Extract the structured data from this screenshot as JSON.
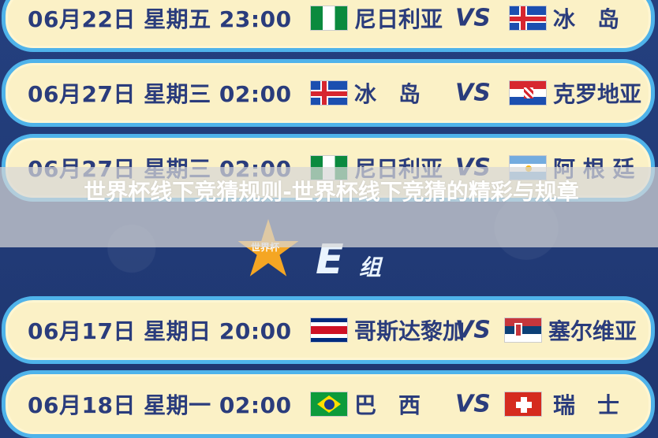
{
  "matches_top": [
    {
      "date": "06月22日 星期五 23:00",
      "home": "尼日利亚",
      "home_flag": "nigeria-flag-icon",
      "vs": "VS",
      "away": "冰　岛",
      "away_flag": "iceland-flag-icon"
    },
    {
      "date": "06月27日 星期三 02:00",
      "home": "冰　岛",
      "home_flag": "iceland-flag-icon",
      "vs": "VS",
      "away": "克罗地亚",
      "away_flag": "croatia-flag-icon"
    },
    {
      "date": "06月27日 星期三 02:00",
      "home": "尼日利亚",
      "home_flag": "nigeria-flag-icon",
      "vs": "VS",
      "away": "阿 根 廷",
      "away_flag": "argentina-flag-icon"
    }
  ],
  "group": {
    "star_text": "世界杯",
    "letter": "E",
    "suffix": "组"
  },
  "matches_bottom": [
    {
      "date": "06月17日 星期日 20:00",
      "home": "哥斯达黎加",
      "home_flag": "costa-rica-flag-icon",
      "vs": "VS",
      "away": "塞尔维亚",
      "away_flag": "serbia-flag-icon"
    },
    {
      "date": "06月18日 星期一 02:00",
      "home": "巴　西",
      "home_flag": "brazil-flag-icon",
      "vs": "VS",
      "away": "瑞　士",
      "away_flag": "switzerland-flag-icon"
    }
  ],
  "overlay_title": "世界杯线下竞猜规则-世界杯线下竞猜的精彩与规章"
}
